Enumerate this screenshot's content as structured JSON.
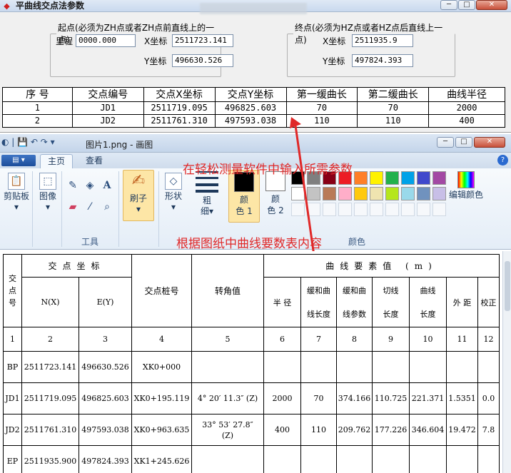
{
  "dialog": {
    "title": "平曲线交点法参数",
    "start_group": {
      "legend": "起点(必须为ZH点或者ZH点前直线上的一点)",
      "mileage_label": "里程",
      "mileage_value": "0000.000",
      "x_label": "X坐标",
      "x_value": "2511723.141",
      "y_label": "Y坐标",
      "y_value": "496630.526"
    },
    "end_group": {
      "legend": "终点(必须为HZ点或者HZ点后直线上一点)",
      "x_label": "X坐标",
      "x_value": "2511935.9",
      "y_label": "Y坐标",
      "y_value": "497824.393"
    },
    "table": {
      "headers": [
        "序  号",
        "交点编号",
        "交点X坐标",
        "交点Y坐标",
        "第一缓曲长",
        "第二缓曲长",
        "曲线半径"
      ],
      "rows": [
        [
          "1",
          "JD1",
          "2511719.095",
          "496825.603",
          "70",
          "70",
          "2000"
        ],
        [
          "2",
          "JD2",
          "2511761.310",
          "497593.038",
          "110",
          "110",
          "400"
        ]
      ]
    },
    "controls": {
      "minimize": "─",
      "maximize": "□",
      "close": "✕"
    }
  },
  "paint": {
    "title": "图片1.png - 画图",
    "tabs": [
      "主页",
      "查看"
    ],
    "menu_label": "▤ ▾",
    "groups": {
      "clipboard": "剪贴板",
      "image": "图像",
      "tools": "工具",
      "brushes": "刷子",
      "shapes": "形状",
      "size": "粗\n细",
      "color1": "颜\n色 1",
      "color2": "颜\n色 2",
      "colors_label": "颜色",
      "edit_colors": "编辑颜色"
    },
    "palette": [
      "#000000",
      "#7f7f7f",
      "#880015",
      "#ed1c24",
      "#ff7f27",
      "#fff200",
      "#22b14c",
      "#00a2e8",
      "#3f48cc",
      "#a349a4",
      "#ffffff",
      "#c3c3c3",
      "#b97a57",
      "#ffaec9",
      "#ffc90e",
      "#efe4b0",
      "#b5e61d",
      "#99d9ea",
      "#7092be",
      "#c8bfe7"
    ],
    "annotation_1": "在轻松测量软件中输入所需参数",
    "annotation_2": "根据图纸中曲线要数表内容",
    "annotation_color": "#e02828",
    "controls": {
      "minimize": "─",
      "maximize": "□",
      "close": "✕"
    }
  },
  "curve_table": {
    "h_jd": "交\n点\n号",
    "h_coords": "交点坐标",
    "h_n": "N(X)",
    "h_e": "E(Y)",
    "h_stake": "交点桩号",
    "h_angle": "转角值",
    "h_elements": "曲线要素值 (m)",
    "h_radius": "半 径",
    "h_ls": "缓和曲\n线长度",
    "h_param": "缓和曲\n线参数",
    "h_tangent": "切线\n长度",
    "h_curve": "曲线\n长度",
    "h_ext": "外 距",
    "h_corr": "校正",
    "num_row": [
      "1",
      "2",
      "3",
      "4",
      "5",
      "6",
      "7",
      "8",
      "9",
      "10",
      "11",
      "12"
    ],
    "rows": [
      [
        "BP",
        "2511723.141",
        "496630.526",
        "XK0+000",
        "",
        "",
        "",
        "",
        "",
        "",
        "",
        ""
      ],
      [
        "JD1",
        "2511719.095",
        "496825.603",
        "XK0+195.119",
        "4° 20′ 11.3″ (Z)",
        "2000",
        "70",
        "374.166",
        "110.725",
        "221.371",
        "1.5351",
        "0.0"
      ],
      [
        "JD2",
        "2511761.310",
        "497593.038",
        "XK0+963.635",
        "33° 53′ 27.8″\n(Z)",
        "400",
        "110",
        "209.762",
        "177.226",
        "346.604",
        "19.472",
        "7.8"
      ],
      [
        "EP",
        "2511935.900",
        "497824.393",
        "XK1+245.626",
        "",
        "",
        "",
        "",
        "",
        "",
        "",
        ""
      ]
    ]
  }
}
